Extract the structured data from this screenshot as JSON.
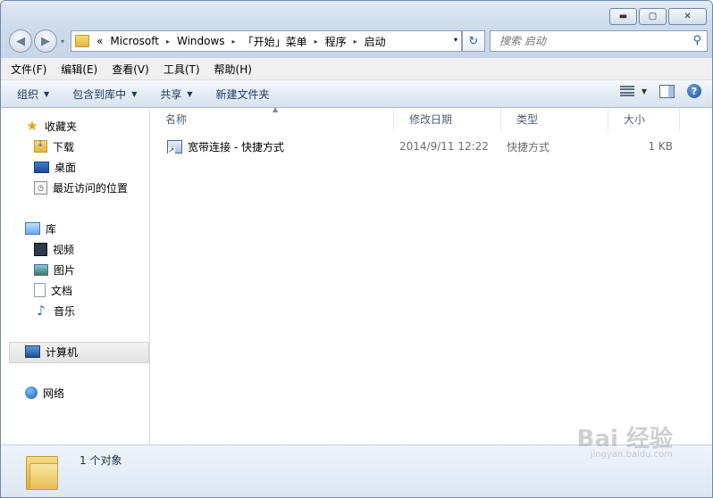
{
  "window": {
    "minimize": "▬",
    "maximize": "▢",
    "close": "✕"
  },
  "nav": {
    "back_icon": "◀",
    "forward_icon": "▶",
    "dropdown": "▾"
  },
  "address": {
    "overflow": "«",
    "crumbs": [
      "Microsoft",
      "Windows",
      "「开始」菜单",
      "程序",
      "启动"
    ],
    "separator": "▸",
    "dropdown": "▾"
  },
  "refresh_icon": "↻",
  "search": {
    "placeholder": "搜索 启动",
    "icon": "🔍"
  },
  "menubar": [
    "文件(F)",
    "编辑(E)",
    "查看(V)",
    "工具(T)",
    "帮助(H)"
  ],
  "toolbar": {
    "organize": "组织",
    "include_library": "包含到库中",
    "share": "共享",
    "new_folder": "新建文件夹",
    "help": "?"
  },
  "sidebar": {
    "favorites": "收藏夹",
    "downloads": "下载",
    "desktop": "桌面",
    "recent": "最近访问的位置",
    "libraries": "库",
    "videos": "视频",
    "pictures": "图片",
    "documents": "文档",
    "music": "音乐",
    "computer": "计算机",
    "network": "网络"
  },
  "columns": {
    "name": "名称",
    "modified": "修改日期",
    "type": "类型",
    "size": "大小"
  },
  "files": [
    {
      "name": "宽带连接 - 快捷方式",
      "modified": "2014/9/11 12:22",
      "type": "快捷方式",
      "size": "1 KB"
    }
  ],
  "details": {
    "count": "1 个对象"
  },
  "watermark": {
    "brand": "Bai 经验",
    "url": "jingyan.baidu.com"
  }
}
